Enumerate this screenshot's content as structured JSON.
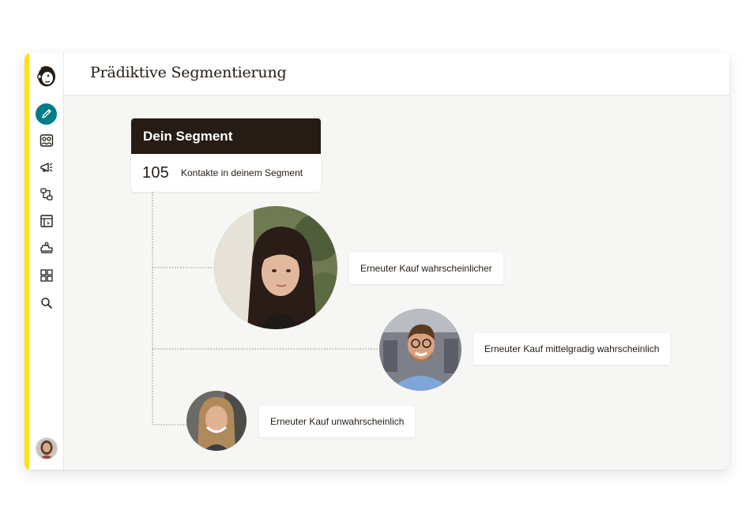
{
  "header": {
    "title": "Prädiktive Segmentierung"
  },
  "sidebar": {
    "items": [
      {
        "name": "create",
        "icon": "pencil-icon",
        "active": true
      },
      {
        "name": "audience",
        "icon": "audience-icon"
      },
      {
        "name": "campaigns",
        "icon": "megaphone-icon"
      },
      {
        "name": "automations",
        "icon": "automation-flow-icon"
      },
      {
        "name": "website",
        "icon": "website-icon"
      },
      {
        "name": "content",
        "icon": "content-studio-icon"
      },
      {
        "name": "integrations",
        "icon": "grid-icon"
      },
      {
        "name": "search",
        "icon": "search-icon"
      }
    ]
  },
  "segment": {
    "title": "Dein Segment",
    "count": "105",
    "count_label": "Kontakte in deinem Segment"
  },
  "predictions": [
    {
      "label": "Erneuter Kauf wahrscheinlicher"
    },
    {
      "label": "Erneuter Kauf mittelgradig wahrscheinlich"
    },
    {
      "label": "Erneuter Kauf unwahrscheinlich"
    }
  ],
  "colors": {
    "accent_yellow": "#ffe01b",
    "active_teal": "#007c89",
    "dark_header": "#241c15",
    "canvas": "#f6f6f4"
  }
}
